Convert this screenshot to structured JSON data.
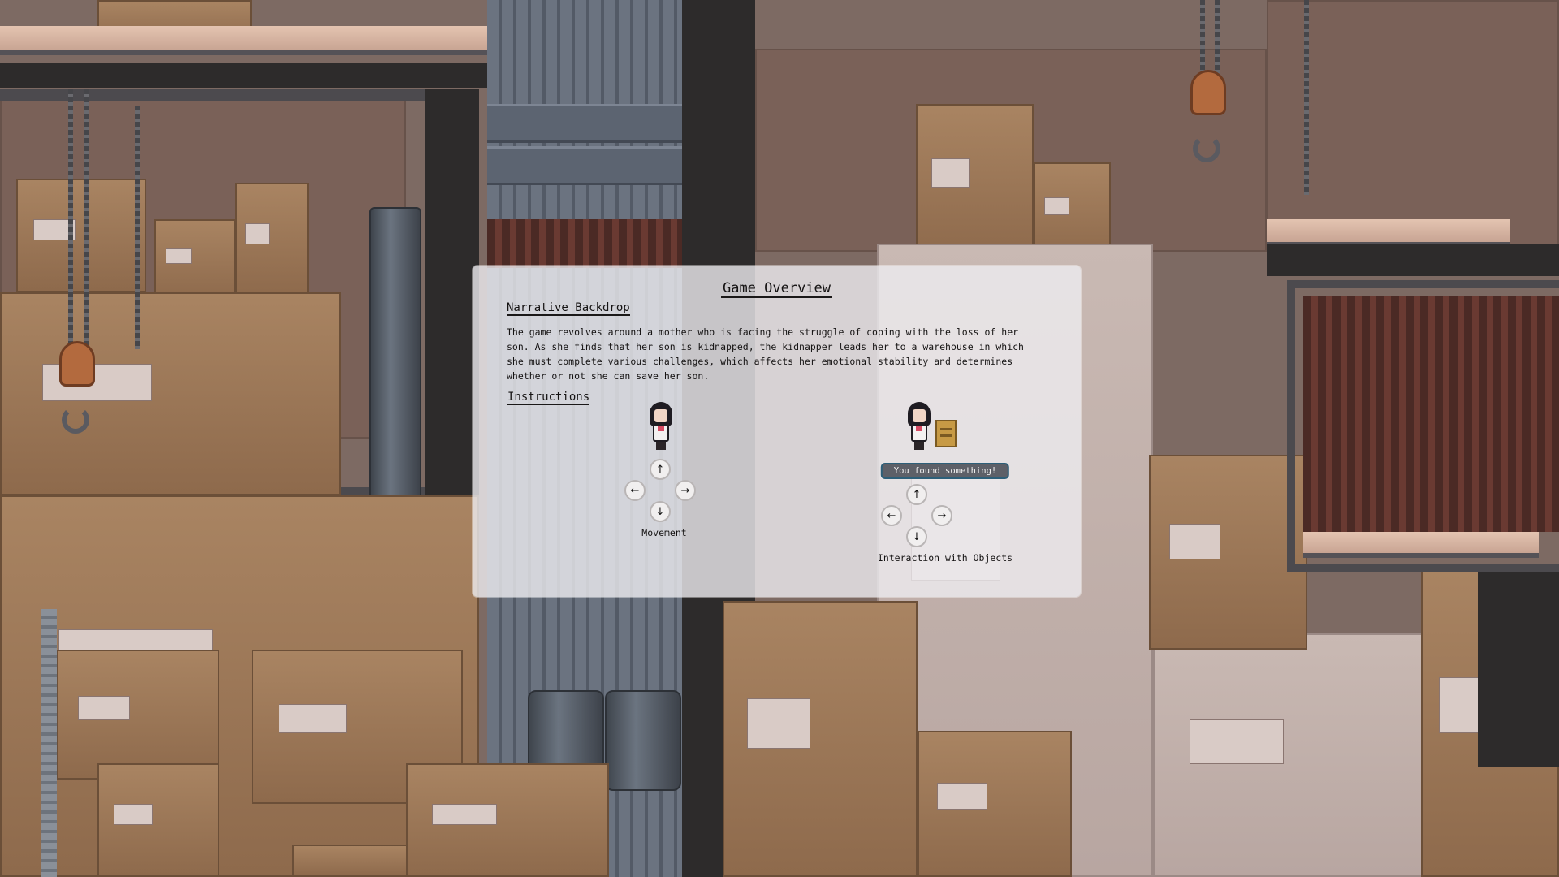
{
  "panel": {
    "title": "Game Overview",
    "narrative_heading": "Narrative Backdrop",
    "narrative_text": "The game revolves around a mother who is facing the struggle of coping with the loss of her son. As she finds that her son is kidnapped, the kidnapper leads her to a warehouse in which she must complete various challenges, which affects her emotional stability and determines whether or not she can save her son.",
    "instructions_heading": "Instructions",
    "movement": {
      "label": "Movement",
      "keys": {
        "up": "↑",
        "left": "←",
        "right": "→",
        "down": "↓"
      }
    },
    "interaction": {
      "label": "Interaction with Objects",
      "toast": "You found something!",
      "keys": {
        "up": "↑",
        "left": "←",
        "right": "→",
        "down": "↓"
      }
    }
  },
  "icons": {
    "character": "mother-sprite-icon",
    "crate": "crate-icon",
    "hook": "crane-hook-icon",
    "arrows": [
      "arrow-up-icon",
      "arrow-left-icon",
      "arrow-right-icon",
      "arrow-down-icon"
    ]
  },
  "colors": {
    "panel_bg": "#eeecf0",
    "toast_bg": "#5d6068",
    "toast_border": "#2d5f79",
    "box_brown": "#a98462",
    "wall_dark": "#2d2b2b"
  }
}
